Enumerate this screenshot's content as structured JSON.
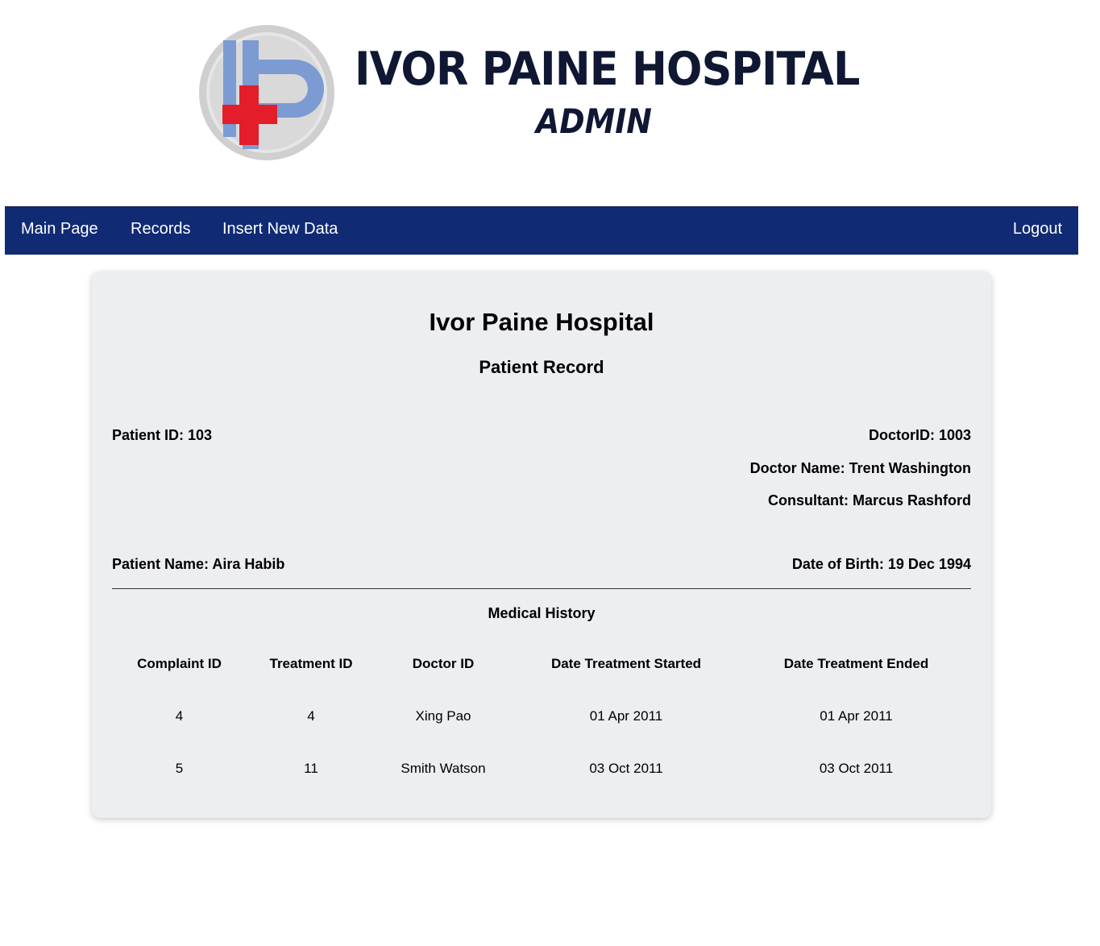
{
  "logo": {
    "title": "IVOR PAINE HOSPITAL",
    "subtitle": "ADMIN",
    "colors": {
      "navy": "#0f1733",
      "blue": "#7b9bd2",
      "red": "#e31e2a",
      "ring": "#cfcfcf"
    }
  },
  "nav": {
    "items": [
      "Main Page",
      "Records",
      "Insert New Data"
    ],
    "logout": "Logout",
    "background": "#102a74"
  },
  "record": {
    "hospital_name": "Ivor Paine Hospital",
    "heading": "Patient Record",
    "patient_id": "Patient ID: 103",
    "doctor_id": "DoctorID: 1003",
    "doctor_name": "Doctor Name: Trent Washington",
    "consultant": "Consultant: Marcus Rashford",
    "patient_name": "Patient Name: Aira Habib",
    "date_of_birth": "Date of Birth: 19 Dec 1994"
  },
  "history": {
    "title": "Medical History",
    "columns": [
      "Complaint ID",
      "Treatment ID",
      "Doctor ID",
      "Date Treatment Started",
      "Date Treatment Ended"
    ],
    "rows": [
      [
        "4",
        "4",
        "Xing Pao",
        "01 Apr 2011",
        "01 Apr 2011"
      ],
      [
        "5",
        "11",
        "Smith Watson",
        "03 Oct 2011",
        "03 Oct 2011"
      ]
    ]
  }
}
